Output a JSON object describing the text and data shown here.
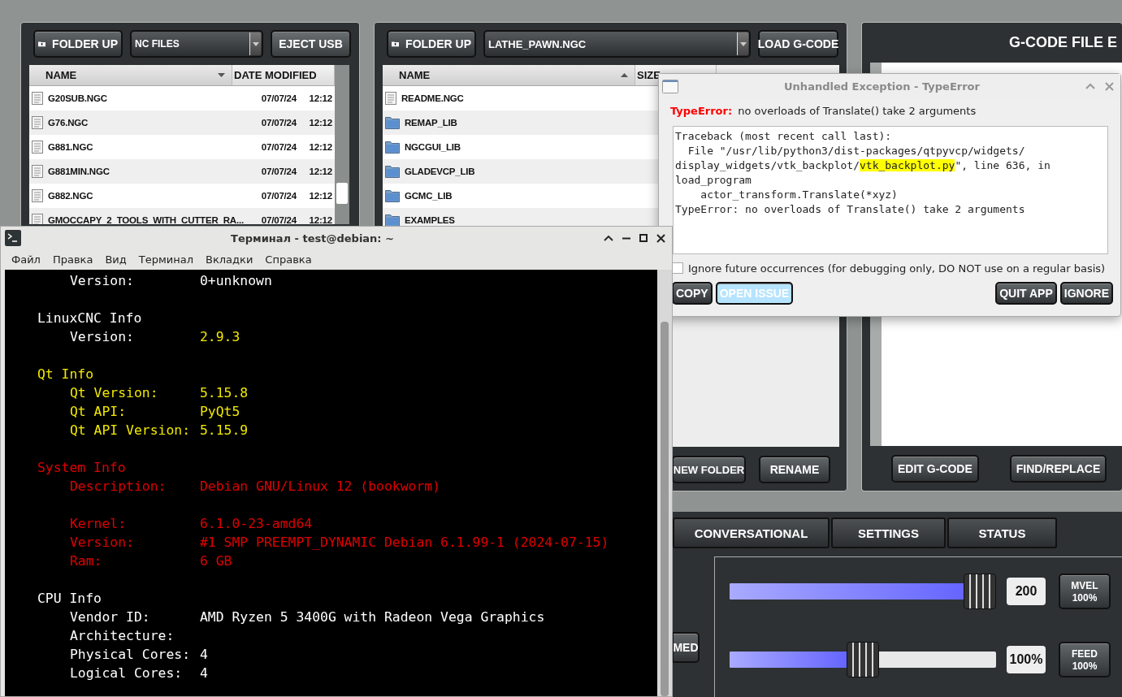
{
  "app": {
    "left_panel": {
      "folder_up": "FOLDER UP",
      "filter": "NC FILES",
      "eject": "EJECT USB",
      "columns": [
        {
          "label": "NAME",
          "sorted": true,
          "ascending": false
        },
        {
          "label": "DATE MODIFIED",
          "sorted": false
        }
      ],
      "rows": [
        {
          "name": "G20SUB.NGC",
          "date": "07/07/24",
          "time": "12:12"
        },
        {
          "name": "G76.NGC",
          "date": "07/07/24",
          "time": "12:12"
        },
        {
          "name": "G881.NGC",
          "date": "07/07/24",
          "time": "12:12"
        },
        {
          "name": "G881MIN.NGC",
          "date": "07/07/24",
          "time": "12:12"
        },
        {
          "name": "G882.NGC",
          "date": "07/07/24",
          "time": "12:12"
        },
        {
          "name": "GMOCCAPY_2_TOOLS_WITH_CUTTER_RA...",
          "date": "07/07/24",
          "time": "12:12"
        }
      ]
    },
    "middle_panel": {
      "folder_up": "FOLDER UP",
      "path": "LATHE_PAWN.NGC",
      "load": "LOAD G-CODE",
      "columns": [
        {
          "label": "NAME",
          "sorted": true,
          "ascending": true
        },
        {
          "label": "SIZE",
          "sorted": false
        }
      ],
      "rows": [
        {
          "name": "README.NGC",
          "kind": "file"
        },
        {
          "name": "REMAP_LIB",
          "kind": "folder"
        },
        {
          "name": "NGCGUI_LIB",
          "kind": "folder"
        },
        {
          "name": "GLADEVCP_LIB",
          "kind": "folder"
        },
        {
          "name": "GCMC_LIB",
          "kind": "folder"
        },
        {
          "name": "EXAMPLES",
          "kind": "folder"
        }
      ],
      "buttons": [
        "NEW FOLDER",
        "RENAME"
      ]
    },
    "editor_panel": {
      "title": "G-CODE FILE E",
      "buttons": [
        "EDIT G-CODE",
        "FIND/REPLACE"
      ]
    },
    "tabs": [
      "CONVERSATIONAL",
      "SETTINGS",
      "STATUS"
    ],
    "side_buttons": [
      "MED"
    ],
    "sliders": [
      {
        "level": 1.0,
        "value": "200",
        "button": [
          "MVEL",
          "100%"
        ]
      },
      {
        "level": 0.5,
        "value": "100%",
        "button": [
          "FEED",
          "100%"
        ]
      }
    ]
  },
  "dialog": {
    "title": "Unhandled Exception - TypeError",
    "error_type": "TypeError:",
    "message": "no overloads of Translate() take 2 arguments",
    "traceback": [
      [
        {
          "text": "Traceback (most recent call last):",
          "highlight": false
        }
      ],
      [
        {
          "text": "  File \"/usr/lib/python3/dist-packages/qtpyvcp/widgets/",
          "highlight": false
        }
      ],
      [
        {
          "text": "display_widgets/vtk_backplot/",
          "highlight": false
        },
        {
          "text": "vtk_backplot.py",
          "highlight": true
        },
        {
          "text": "\", line 636, in",
          "highlight": false
        }
      ],
      [
        {
          "text": "load_program",
          "highlight": false
        }
      ],
      [
        {
          "text": "    actor_transform.Translate(*xyz)",
          "highlight": false
        }
      ],
      [
        {
          "text": "TypeError: no overloads of Translate() take 2 arguments",
          "highlight": false
        }
      ]
    ],
    "checkbox": {
      "label": "Ignore future occurrences (for debugging only, DO NOT use on a regular basis)",
      "checked": false
    },
    "left_buttons": [
      {
        "label": "COPY",
        "focused": false
      },
      {
        "label": "OPEN ISSUE",
        "focused": true
      }
    ],
    "right_buttons": [
      {
        "label": "QUIT APP",
        "focused": false
      },
      {
        "label": "IGNORE",
        "focused": false
      }
    ]
  },
  "terminal": {
    "title": "Терминал - test@debian: ~",
    "menu": [
      "Файл",
      "Правка",
      "Вид",
      "Терминал",
      "Вкладки",
      "Справка"
    ],
    "lines": [
      {
        "kind": "field",
        "label": {
          "text": "Version:",
          "color": "#ffffff"
        },
        "value": {
          "text": "0+unknown",
          "color": "#ffffff"
        }
      },
      {
        "kind": "blank"
      },
      {
        "kind": "heading",
        "text": "LinuxCNC Info",
        "color": "#ffffff"
      },
      {
        "kind": "field",
        "label": {
          "text": "Version:",
          "color": "#ffffff"
        },
        "value": {
          "text": "2.9.3",
          "color": "#f0e800"
        }
      },
      {
        "kind": "blank"
      },
      {
        "kind": "heading",
        "text": "Qt Info",
        "color": "#f0e800"
      },
      {
        "kind": "field",
        "label": {
          "text": "Qt Version:",
          "color": "#f0e800"
        },
        "value": {
          "text": "5.15.8",
          "color": "#f0e800"
        }
      },
      {
        "kind": "field",
        "label": {
          "text": "Qt API:",
          "color": "#f0e800"
        },
        "value": {
          "text": "PyQt5",
          "color": "#f0e800"
        }
      },
      {
        "kind": "field",
        "label": {
          "text": "Qt API Version:",
          "color": "#f0e800"
        },
        "value": {
          "text": "5.15.9",
          "color": "#f0e800"
        }
      },
      {
        "kind": "blank"
      },
      {
        "kind": "heading",
        "text": "System Info",
        "color": "#e00000"
      },
      {
        "kind": "field",
        "label": {
          "text": "Description:",
          "color": "#e00000"
        },
        "value": {
          "text": "Debian GNU/Linux 12 (bookworm)",
          "color": "#e00000"
        }
      },
      {
        "kind": "blank"
      },
      {
        "kind": "field",
        "label": {
          "text": "Kernel:",
          "color": "#e00000"
        },
        "value": {
          "text": "6.1.0-23-amd64",
          "color": "#e00000"
        }
      },
      {
        "kind": "field",
        "label": {
          "text": "Version:",
          "color": "#e00000"
        },
        "value": {
          "text": "#1 SMP PREEMPT_DYNAMIC Debian 6.1.99-1 (2024-07-15)",
          "color": "#e00000"
        }
      },
      {
        "kind": "field",
        "label": {
          "text": "Ram:",
          "color": "#e00000"
        },
        "value": {
          "text": "6 GB",
          "color": "#e00000"
        }
      },
      {
        "kind": "blank"
      },
      {
        "kind": "heading",
        "text": "CPU Info",
        "color": "#ffffff"
      },
      {
        "kind": "field",
        "label": {
          "text": "Vendor ID:",
          "color": "#ffffff"
        },
        "value": {
          "text": "AMD Ryzen 5 3400G with Radeon Vega Graphics",
          "color": "#ffffff"
        }
      },
      {
        "kind": "field",
        "label": {
          "text": "Architecture:",
          "color": "#ffffff"
        }
      },
      {
        "kind": "field",
        "label": {
          "text": "Physical Cores:",
          "color": "#ffffff"
        },
        "value": {
          "text": "4",
          "color": "#ffffff"
        }
      },
      {
        "kind": "field",
        "label": {
          "text": "Logical Cores:",
          "color": "#ffffff"
        },
        "value": {
          "text": "4",
          "color": "#ffffff"
        }
      }
    ]
  }
}
